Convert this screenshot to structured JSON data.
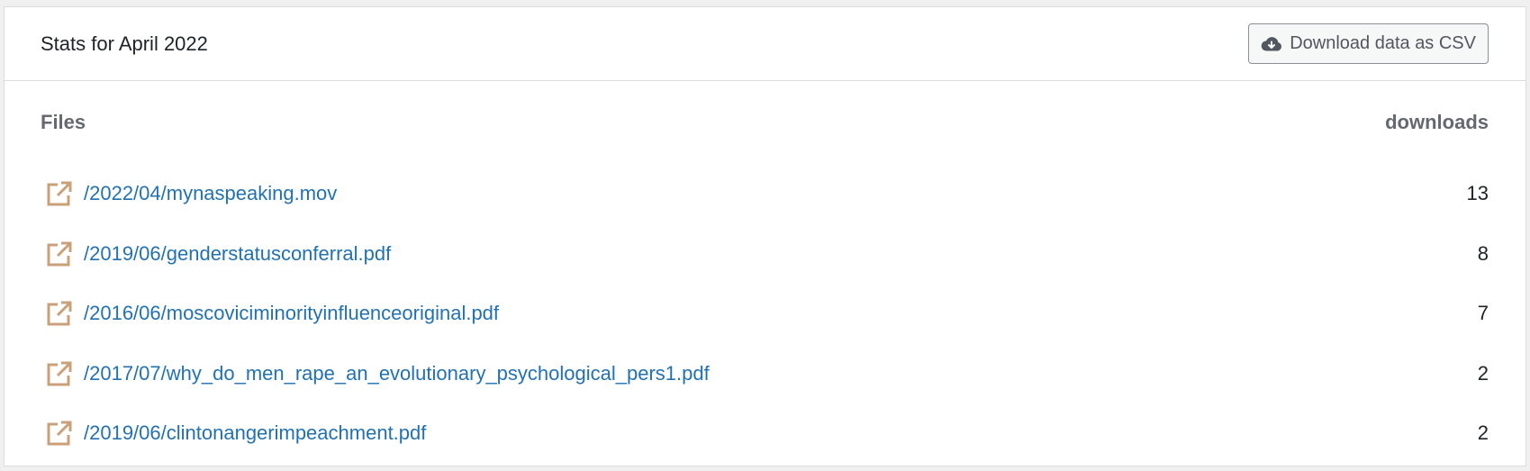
{
  "header": {
    "title": "Stats for April 2022",
    "download_button": {
      "label": "Download data as CSV",
      "icon": "cloud-download-icon"
    }
  },
  "table": {
    "columns": {
      "files": "Files",
      "downloads": "downloads"
    },
    "rows": [
      {
        "file": "/2022/04/mynaspeaking.mov",
        "downloads": "13"
      },
      {
        "file": "/2019/06/genderstatusconferral.pdf",
        "downloads": "8"
      },
      {
        "file": "/2016/06/moscoviciminorityinfluenceoriginal.pdf",
        "downloads": "7"
      },
      {
        "file": "/2017/07/why_do_men_rape_an_evolutionary_psychological_pers1.pdf",
        "downloads": "2"
      },
      {
        "file": "/2019/06/clintonangerimpeachment.pdf",
        "downloads": "2"
      }
    ]
  },
  "colors": {
    "link": "#2271b1",
    "external_icon": "#c9a07a",
    "border": "#dcdcde",
    "header_text": "#646970"
  }
}
